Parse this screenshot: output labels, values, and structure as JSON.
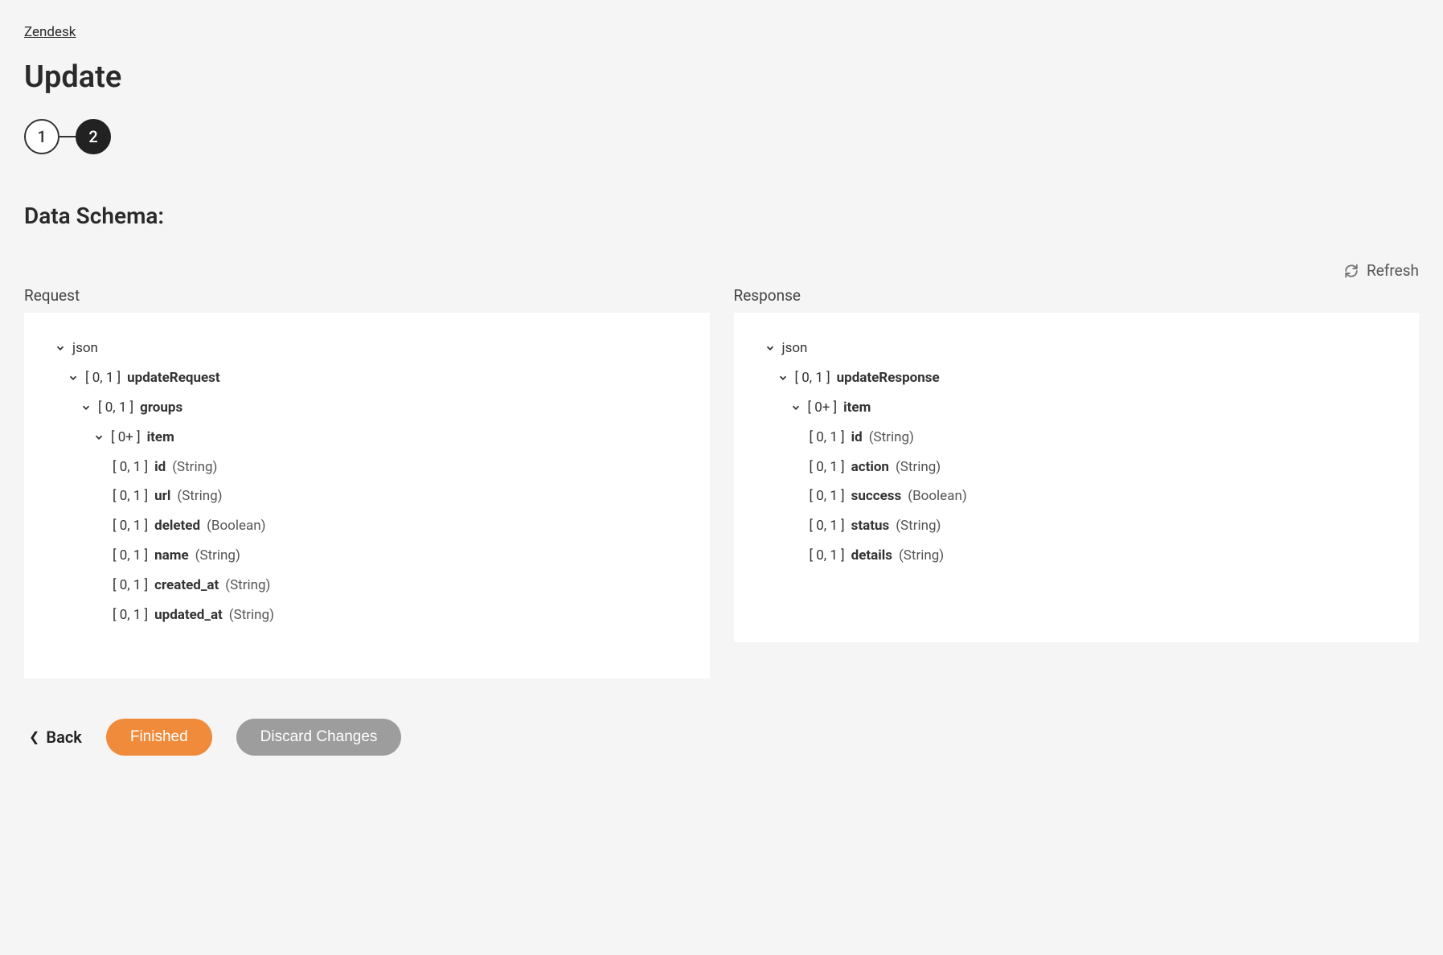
{
  "breadcrumb": "Zendesk",
  "title": "Update",
  "steps": {
    "one": "1",
    "two": "2"
  },
  "section_label": "Data Schema:",
  "refresh": "Refresh",
  "panels": {
    "request": {
      "header": "Request",
      "root": "json",
      "nodes": {
        "updateRequest": {
          "card": "[ 0, 1 ]",
          "name": "updateRequest"
        },
        "groups": {
          "card": "[ 0, 1 ]",
          "name": "groups"
        },
        "item": {
          "card": "[ 0+ ]",
          "name": "item"
        },
        "id": {
          "card": "[ 0, 1 ]",
          "name": "id",
          "type": "(String)"
        },
        "url": {
          "card": "[ 0, 1 ]",
          "name": "url",
          "type": "(String)"
        },
        "deleted": {
          "card": "[ 0, 1 ]",
          "name": "deleted",
          "type": "(Boolean)"
        },
        "e_name": {
          "card": "[ 0, 1 ]",
          "name": "name",
          "type": "(String)"
        },
        "created_at": {
          "card": "[ 0, 1 ]",
          "name": "created_at",
          "type": "(String)"
        },
        "updated_at": {
          "card": "[ 0, 1 ]",
          "name": "updated_at",
          "type": "(String)"
        }
      }
    },
    "response": {
      "header": "Response",
      "root": "json",
      "nodes": {
        "updateResponse": {
          "card": "[ 0, 1 ]",
          "name": "updateResponse"
        },
        "item": {
          "card": "[ 0+ ]",
          "name": "item"
        },
        "id": {
          "card": "[ 0, 1 ]",
          "name": "id",
          "type": "(String)"
        },
        "action": {
          "card": "[ 0, 1 ]",
          "name": "action",
          "type": "(String)"
        },
        "success": {
          "card": "[ 0, 1 ]",
          "name": "success",
          "type": "(Boolean)"
        },
        "status": {
          "card": "[ 0, 1 ]",
          "name": "status",
          "type": "(String)"
        },
        "details": {
          "card": "[ 0, 1 ]",
          "name": "details",
          "type": "(String)"
        }
      }
    }
  },
  "footer": {
    "back": "Back",
    "finished": "Finished",
    "discard": "Discard Changes"
  }
}
